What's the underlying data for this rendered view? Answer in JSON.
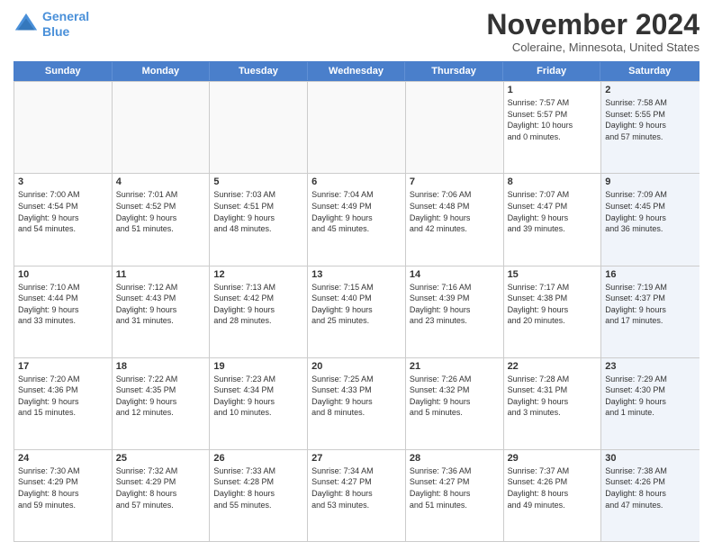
{
  "logo": {
    "line1": "General",
    "line2": "Blue"
  },
  "header": {
    "title": "November 2024",
    "location": "Coleraine, Minnesota, United States"
  },
  "days_of_week": [
    "Sunday",
    "Monday",
    "Tuesday",
    "Wednesday",
    "Thursday",
    "Friday",
    "Saturday"
  ],
  "weeks": [
    [
      {
        "day": "",
        "content": ""
      },
      {
        "day": "",
        "content": ""
      },
      {
        "day": "",
        "content": ""
      },
      {
        "day": "",
        "content": ""
      },
      {
        "day": "",
        "content": ""
      },
      {
        "day": "1",
        "content": "Sunrise: 7:57 AM\nSunset: 5:57 PM\nDaylight: 10 hours\nand 0 minutes."
      },
      {
        "day": "2",
        "content": "Sunrise: 7:58 AM\nSunset: 5:55 PM\nDaylight: 9 hours\nand 57 minutes."
      }
    ],
    [
      {
        "day": "3",
        "content": "Sunrise: 7:00 AM\nSunset: 4:54 PM\nDaylight: 9 hours\nand 54 minutes."
      },
      {
        "day": "4",
        "content": "Sunrise: 7:01 AM\nSunset: 4:52 PM\nDaylight: 9 hours\nand 51 minutes."
      },
      {
        "day": "5",
        "content": "Sunrise: 7:03 AM\nSunset: 4:51 PM\nDaylight: 9 hours\nand 48 minutes."
      },
      {
        "day": "6",
        "content": "Sunrise: 7:04 AM\nSunset: 4:49 PM\nDaylight: 9 hours\nand 45 minutes."
      },
      {
        "day": "7",
        "content": "Sunrise: 7:06 AM\nSunset: 4:48 PM\nDaylight: 9 hours\nand 42 minutes."
      },
      {
        "day": "8",
        "content": "Sunrise: 7:07 AM\nSunset: 4:47 PM\nDaylight: 9 hours\nand 39 minutes."
      },
      {
        "day": "9",
        "content": "Sunrise: 7:09 AM\nSunset: 4:45 PM\nDaylight: 9 hours\nand 36 minutes."
      }
    ],
    [
      {
        "day": "10",
        "content": "Sunrise: 7:10 AM\nSunset: 4:44 PM\nDaylight: 9 hours\nand 33 minutes."
      },
      {
        "day": "11",
        "content": "Sunrise: 7:12 AM\nSunset: 4:43 PM\nDaylight: 9 hours\nand 31 minutes."
      },
      {
        "day": "12",
        "content": "Sunrise: 7:13 AM\nSunset: 4:42 PM\nDaylight: 9 hours\nand 28 minutes."
      },
      {
        "day": "13",
        "content": "Sunrise: 7:15 AM\nSunset: 4:40 PM\nDaylight: 9 hours\nand 25 minutes."
      },
      {
        "day": "14",
        "content": "Sunrise: 7:16 AM\nSunset: 4:39 PM\nDaylight: 9 hours\nand 23 minutes."
      },
      {
        "day": "15",
        "content": "Sunrise: 7:17 AM\nSunset: 4:38 PM\nDaylight: 9 hours\nand 20 minutes."
      },
      {
        "day": "16",
        "content": "Sunrise: 7:19 AM\nSunset: 4:37 PM\nDaylight: 9 hours\nand 17 minutes."
      }
    ],
    [
      {
        "day": "17",
        "content": "Sunrise: 7:20 AM\nSunset: 4:36 PM\nDaylight: 9 hours\nand 15 minutes."
      },
      {
        "day": "18",
        "content": "Sunrise: 7:22 AM\nSunset: 4:35 PM\nDaylight: 9 hours\nand 12 minutes."
      },
      {
        "day": "19",
        "content": "Sunrise: 7:23 AM\nSunset: 4:34 PM\nDaylight: 9 hours\nand 10 minutes."
      },
      {
        "day": "20",
        "content": "Sunrise: 7:25 AM\nSunset: 4:33 PM\nDaylight: 9 hours\nand 8 minutes."
      },
      {
        "day": "21",
        "content": "Sunrise: 7:26 AM\nSunset: 4:32 PM\nDaylight: 9 hours\nand 5 minutes."
      },
      {
        "day": "22",
        "content": "Sunrise: 7:28 AM\nSunset: 4:31 PM\nDaylight: 9 hours\nand 3 minutes."
      },
      {
        "day": "23",
        "content": "Sunrise: 7:29 AM\nSunset: 4:30 PM\nDaylight: 9 hours\nand 1 minute."
      }
    ],
    [
      {
        "day": "24",
        "content": "Sunrise: 7:30 AM\nSunset: 4:29 PM\nDaylight: 8 hours\nand 59 minutes."
      },
      {
        "day": "25",
        "content": "Sunrise: 7:32 AM\nSunset: 4:29 PM\nDaylight: 8 hours\nand 57 minutes."
      },
      {
        "day": "26",
        "content": "Sunrise: 7:33 AM\nSunset: 4:28 PM\nDaylight: 8 hours\nand 55 minutes."
      },
      {
        "day": "27",
        "content": "Sunrise: 7:34 AM\nSunset: 4:27 PM\nDaylight: 8 hours\nand 53 minutes."
      },
      {
        "day": "28",
        "content": "Sunrise: 7:36 AM\nSunset: 4:27 PM\nDaylight: 8 hours\nand 51 minutes."
      },
      {
        "day": "29",
        "content": "Sunrise: 7:37 AM\nSunset: 4:26 PM\nDaylight: 8 hours\nand 49 minutes."
      },
      {
        "day": "30",
        "content": "Sunrise: 7:38 AM\nSunset: 4:26 PM\nDaylight: 8 hours\nand 47 minutes."
      }
    ]
  ]
}
